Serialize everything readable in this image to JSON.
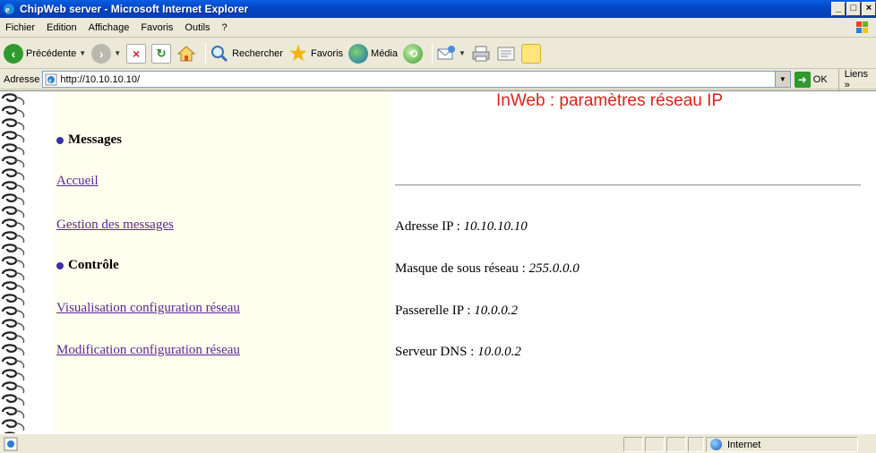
{
  "window": {
    "title": "ChipWeb server - Microsoft Internet Explorer"
  },
  "menu": {
    "items": [
      "Fichier",
      "Edition",
      "Affichage",
      "Favoris",
      "Outils",
      "?"
    ]
  },
  "toolbar": {
    "back_label": "Précédente",
    "search_label": "Rechercher",
    "favorites_label": "Favoris",
    "media_label": "Média"
  },
  "address": {
    "label": "Adresse",
    "value": "http://10.10.10.10/",
    "go_label": "OK",
    "links_label": "Liens"
  },
  "nav": {
    "messages_heading": "Messages",
    "accueil_link": "Accueil",
    "gestion_link": "Gestion des messages",
    "controle_heading": "Contrôle",
    "visualisation_link": "Visualisation configuration réseau",
    "modification_link": "Modification configuration réseau"
  },
  "main": {
    "title": "InWeb : paramètres réseau IP",
    "ip_label": "Adresse IP : ",
    "ip_value": "10.10.10.10",
    "mask_label": "Masque de sous réseau : ",
    "mask_value": "255.0.0.0",
    "gateway_label": "Passerelle IP : ",
    "gateway_value": "10.0.0.2",
    "dns_label": "Serveur DNS : ",
    "dns_value": "10.0.0.2"
  },
  "status": {
    "zone_label": "Internet"
  },
  "colors": {
    "title_red": "#e0221a",
    "link_purple": "#5b2596",
    "bullet": "#3b2fa8",
    "nav_bg": "#fffff0"
  }
}
